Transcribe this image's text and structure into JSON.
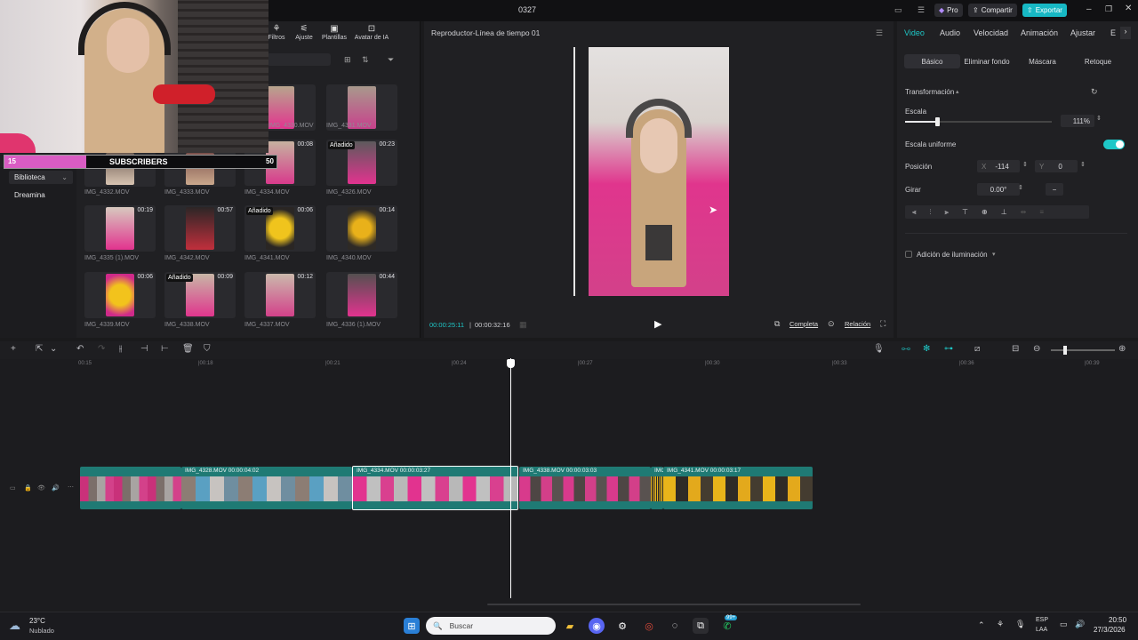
{
  "window": {
    "title": "0327",
    "pro_label": "Pro",
    "share_label": "Compartir",
    "export_label": "Exportar"
  },
  "media": {
    "tools": [
      {
        "label": "Filtros",
        "icon": "filter-icon"
      },
      {
        "label": "Ajuste",
        "icon": "adjust-icon"
      },
      {
        "label": "Plantillas",
        "icon": "template-icon"
      },
      {
        "label": "Avatar de IA",
        "icon": "avatar-icon"
      }
    ],
    "sidebar": [
      {
        "label": "Biblioteca"
      },
      {
        "label": "Dreamina"
      }
    ],
    "subscribers": {
      "left": "15",
      "label": "SUBSCRIBERS",
      "right": "50"
    },
    "rows": [
      [
        {
          "name": "IMG_4330.MOV",
          "dur": "",
          "tag": ""
        },
        {
          "name": "IMG_4331.MOV",
          "dur": "",
          "tag": ""
        }
      ],
      [
        {
          "name": "IMG_4332.MOV",
          "dur": "",
          "tag": ""
        },
        {
          "name": "IMG_4333.MOV",
          "dur": "",
          "tag": ""
        },
        {
          "name": "IMG_4334.MOV",
          "dur": "00:08",
          "tag": ""
        },
        {
          "name": "IMG_4326.MOV",
          "dur": "00:23",
          "tag": "Añadido"
        }
      ],
      [
        {
          "name": "IMG_4335 (1).MOV",
          "dur": "00:19",
          "tag": ""
        },
        {
          "name": "IMG_4342.MOV",
          "dur": "00:57",
          "tag": ""
        },
        {
          "name": "IMG_4341.MOV",
          "dur": "00:06",
          "tag": "Añadido"
        },
        {
          "name": "IMG_4340.MOV",
          "dur": "00:14",
          "tag": ""
        }
      ],
      [
        {
          "name": "IMG_4339.MOV",
          "dur": "00:06",
          "tag": ""
        },
        {
          "name": "IMG_4338.MOV",
          "dur": "00:09",
          "tag": "Añadido"
        },
        {
          "name": "IMG_4337.MOV",
          "dur": "00:12",
          "tag": ""
        },
        {
          "name": "IMG_4336 (1).MOV",
          "dur": "00:44",
          "tag": ""
        }
      ]
    ]
  },
  "player": {
    "title": "Reproductor-Línea de tiempo 01",
    "current": "00:00:25:11",
    "total": "00:00:32:16",
    "completa": "Completa",
    "relacion": "Relación"
  },
  "inspector": {
    "tabs": [
      "Video",
      "Audio",
      "Velocidad",
      "Animación",
      "Ajustar",
      "E"
    ],
    "subtabs": [
      "Básico",
      "Eliminar fondo",
      "Máscara",
      "Retoque"
    ],
    "section": "Transformación",
    "scale_label": "Escala",
    "scale_value": "111%",
    "scale_level": 0.22,
    "uniform_label": "Escala uniforme",
    "position_label": "Posición",
    "x_label": "X",
    "x_value": "-114",
    "y_label": "Y",
    "y_value": "0",
    "rotate_label": "Girar",
    "rotate_value": "0.00°",
    "rotate_btn": "−",
    "lighting_label": "Adición de iluminación"
  },
  "timeline": {
    "ruler": [
      "00:15",
      "|00:18",
      "|00:21",
      "|00:24",
      "|00:27",
      "|00:30",
      "|00:33",
      "|00:36",
      "|00:39"
    ],
    "clips": [
      {
        "label": "",
        "colors": [
          "#c9317a",
          "#7b6f6a",
          "#a8a4a2",
          "#d3418a"
        ]
      },
      {
        "label": "IMG_4328.MOV  00:00:04:02",
        "colors": [
          "#8c7d74",
          "#5aa0c2",
          "#c7c3c0",
          "#6f8ea0"
        ]
      },
      {
        "label": "IMG_4334.MOV  00:00:03:27",
        "colors": [
          "#e2338f",
          "#c0c0c0",
          "#d9408f",
          "#b8b8b8"
        ]
      },
      {
        "label": "IMG_4338.MOV  00:00:03:03",
        "colors": [
          "#d83a8c",
          "#4e4644",
          "#d33f89",
          "#595250"
        ]
      },
      {
        "label": "IMG",
        "colors": [
          "#e3b21b",
          "#2c2a28"
        ]
      },
      {
        "label": "IMG_4341.MOV  00:00:03:17",
        "colors": [
          "#e8b41a",
          "#2f2b27",
          "#e3a91c",
          "#443c30"
        ]
      }
    ]
  },
  "taskbar": {
    "temp": "23°C",
    "weather": "Nublado",
    "search": "Buscar",
    "lang1": "ESP",
    "lang2": "LAA",
    "time": "20:50",
    "date": "27/3/2026",
    "badge": "99+"
  },
  "colors": {
    "accent": "#1ec7c7",
    "clip": "#1f7a74",
    "pink": "#e2338f",
    "export": "#17b8c4"
  }
}
